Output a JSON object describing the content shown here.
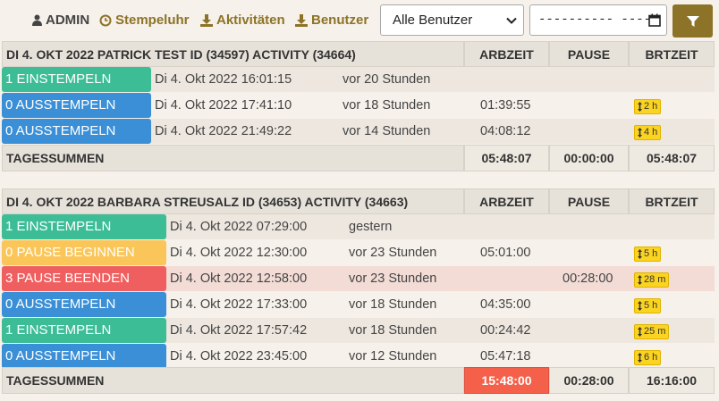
{
  "nav": {
    "admin": "ADMIN",
    "stempeluhr": "Stempeluhr",
    "aktivitaeten": "Aktivitäten",
    "benutzer": "Benutzer",
    "icons": [
      "user-icon",
      "clock-icon",
      "download-icon",
      "download-icon"
    ]
  },
  "filters": {
    "user_select": "Alle Benutzer",
    "date_value": "---------- ----",
    "filter_button_icon": "filter-icon"
  },
  "colors": {
    "accent": "#8c7328",
    "einstempeln": "#3dbd96",
    "ausstempeln": "#3a8fd6",
    "pause_beginnen": "#fbc659",
    "pause_beenden": "#f05f5f",
    "badge": "#fbd321",
    "highlight_sum": "#f5604a"
  },
  "sections": [
    {
      "title": "DI 4. OKT 2022   PATRICK TEST   ID (34597)   ACTIVITY (34664)",
      "columns": [
        "ARBZEIT",
        "PAUSE",
        "BRTZEIT"
      ],
      "rows": [
        {
          "action": "1 EINSTEMPELN",
          "type": "einstempeln",
          "timestamp": "Di 4. Okt 2022 16:01:15",
          "relative": "vor 20 Stunden",
          "arbzeit": "",
          "pause": "",
          "badge": ""
        },
        {
          "action": "0 AUSSTEMPELN",
          "type": "ausstempeln",
          "timestamp": "Di 4. Okt 2022 17:41:10",
          "relative": "vor 18 Stunden",
          "arbzeit": "01:39:55",
          "pause": "",
          "badge": "2 h"
        },
        {
          "action": "0 AUSSTEMPELN",
          "type": "ausstempeln",
          "timestamp": "Di 4. Okt 2022 21:49:22",
          "relative": "vor 14 Stunden",
          "arbzeit": "04:08:12",
          "pause": "",
          "badge": "4 h"
        }
      ],
      "summary": {
        "label": "TAGESSUMMEN",
        "arbzeit": "05:48:07",
        "pause": "00:00:00",
        "brtzeit": "05:48:07"
      }
    },
    {
      "title": "DI 4. OKT 2022   BARBARA STREUSALZ   ID (34653)   ACTIVITY (34663)",
      "columns": [
        "ARBZEIT",
        "PAUSE",
        "BRTZEIT"
      ],
      "rows": [
        {
          "action": "1 EINSTEMPELN",
          "type": "einstempeln",
          "timestamp": "Di 4. Okt 2022 07:29:00",
          "relative": "gestern",
          "arbzeit": "",
          "pause": "",
          "badge": ""
        },
        {
          "action": "0 PAUSE BEGINNEN",
          "type": "pause_beginnen",
          "timestamp": "Di 4. Okt 2022 12:30:00",
          "relative": "vor 23 Stunden",
          "arbzeit": "05:01:00",
          "pause": "",
          "badge": "5 h"
        },
        {
          "action": "3 PAUSE BEENDEN",
          "type": "pause_beenden",
          "timestamp": "Di 4. Okt 2022 12:58:00",
          "relative": "vor 23 Stunden",
          "arbzeit": "",
          "pause": "00:28:00",
          "badge": "28 m"
        },
        {
          "action": "0 AUSSTEMPELN",
          "type": "ausstempeln",
          "timestamp": "Di 4. Okt 2022 17:33:00",
          "relative": "vor 18 Stunden",
          "arbzeit": "04:35:00",
          "pause": "",
          "badge": "5 h"
        },
        {
          "action": "1 EINSTEMPELN",
          "type": "einstempeln",
          "timestamp": "Di 4. Okt 2022 17:57:42",
          "relative": "vor 18 Stunden",
          "arbzeit": "00:24:42",
          "pause": "",
          "badge": "25 m"
        },
        {
          "action": "0 AUSSTEMPELN",
          "type": "ausstempeln",
          "timestamp": "Di 4. Okt 2022 23:45:00",
          "relative": "vor 12 Stunden",
          "arbzeit": "05:47:18",
          "pause": "",
          "badge": "6 h"
        }
      ],
      "summary": {
        "label": "TAGESSUMMEN",
        "arbzeit": "15:48:00",
        "pause": "00:28:00",
        "brtzeit": "16:16:00",
        "arbzeit_highlight": true
      }
    }
  ]
}
